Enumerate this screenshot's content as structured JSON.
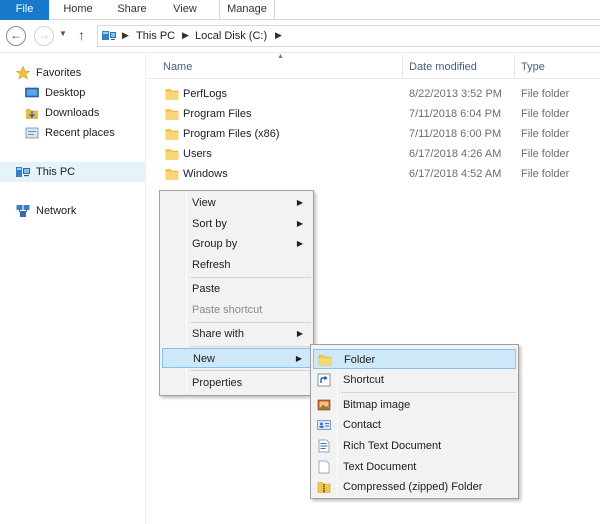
{
  "ribbon": {
    "tabs": [
      "File",
      "Home",
      "Share",
      "View",
      "Manage"
    ]
  },
  "address": {
    "crumbs": [
      "This PC",
      "Local Disk (C:)"
    ],
    "pc_icon": "computer-icon"
  },
  "navpane": {
    "favorites": "Favorites",
    "favorites_items": [
      "Desktop",
      "Downloads",
      "Recent places"
    ],
    "this_pc": "This PC",
    "network": "Network"
  },
  "columns": {
    "name": "Name",
    "date": "Date modified",
    "type": "Type"
  },
  "files": [
    {
      "name": "PerfLogs",
      "date": "8/22/2013 3:52 PM",
      "type": "File folder"
    },
    {
      "name": "Program Files",
      "date": "7/11/2018 6:04 PM",
      "type": "File folder"
    },
    {
      "name": "Program Files (x86)",
      "date": "7/11/2018 6:00 PM",
      "type": "File folder"
    },
    {
      "name": "Users",
      "date": "6/17/2018 4:26 AM",
      "type": "File folder"
    },
    {
      "name": "Windows",
      "date": "6/17/2018 4:52 AM",
      "type": "File folder"
    }
  ],
  "context_menu": {
    "view": "View",
    "sort_by": "Sort by",
    "group_by": "Group by",
    "refresh": "Refresh",
    "paste": "Paste",
    "paste_shortcut": "Paste shortcut",
    "share_with": "Share with",
    "new": "New",
    "properties": "Properties"
  },
  "new_submenu": {
    "folder": "Folder",
    "shortcut": "Shortcut",
    "bitmap": "Bitmap image",
    "contact": "Contact",
    "rtf": "Rich Text Document",
    "text": "Text Document",
    "zip": "Compressed (zipped) Folder"
  },
  "colors": {
    "file_tab": "#1979ca",
    "highlight": "#cde8f9",
    "highlight_border": "#82c3f0",
    "folder": "#f4c64f"
  }
}
